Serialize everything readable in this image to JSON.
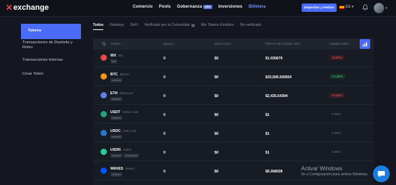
{
  "header": {
    "logo_mark": "✕",
    "logo_text": "exchange",
    "nav": [
      {
        "label": "Comercio",
        "active": false
      },
      {
        "label": "Pools",
        "active": false
      },
      {
        "label": "Gobernanza",
        "active": false,
        "badge": "NEW"
      },
      {
        "label": "Inversiones",
        "active": false
      },
      {
        "label": "Billetera",
        "active": true
      }
    ],
    "deposit_button": "Depositar y Retirar",
    "language": "ES",
    "icons": [
      "bell-icon",
      "avatar"
    ]
  },
  "sidebar": {
    "items": [
      {
        "label": "Tokens",
        "active": true
      },
      {
        "label": "Transacciones de Depósito y Retiro",
        "active": false
      },
      {
        "label": "Transacciones Internas",
        "active": false
      },
      {
        "label": "Crear Token",
        "active": false
      }
    ]
  },
  "tabs": [
    {
      "label": "Todos",
      "active": true
    },
    {
      "label": "Gateway",
      "active": false
    },
    {
      "label": "DeFi",
      "active": false
    },
    {
      "label": "Verificado por la Comunidad",
      "active": false,
      "info": true
    },
    {
      "label": "Mis Tokens Emitidos",
      "active": false
    },
    {
      "label": "No verificado",
      "active": false
    }
  ],
  "table": {
    "columns": [
      "TOKEN ↕",
      "SALDO ↕",
      "SALDO USD ↕",
      "PRECIO DEL TOKEN, USD ↕",
      "CAMBIO 24HS ↕"
    ],
    "rows": [
      {
        "symbol": "WX",
        "name": "WX",
        "tags": [
          "DEX"
        ],
        "balance": "0",
        "balance_usd": "$0",
        "price": "$1.030679",
        "change": "-5.57%",
        "trend": "neg",
        "icon_color": "#e64a4a",
        "icon": "wx-icon"
      },
      {
        "symbol": "BTC",
        "name": "Bitcoin",
        "tags": [
          "GATEWAY"
        ],
        "balance": "0",
        "balance_usd": "$0",
        "price": "$33,506.592824",
        "change": "+3.45%",
        "trend": "pos",
        "icon_color": "#f7931a",
        "icon": "bitcoin-icon"
      },
      {
        "symbol": "ETH",
        "name": "Ethereum",
        "tags": [
          "GATEWAY"
        ],
        "balance": "0",
        "balance_usd": "$0",
        "price": "$2,435.54394",
        "change": "-0.12%",
        "trend": "neg",
        "icon_color": "#627eea",
        "icon": "ethereum-icon"
      },
      {
        "symbol": "USDT",
        "name": "Tether USD",
        "tags": [
          "GATEWAY"
        ],
        "balance": "0",
        "balance_usd": "$0",
        "price": "$1",
        "change": "0.00%",
        "trend": "zero",
        "icon_color": "#26a17b",
        "icon": "tether-icon"
      },
      {
        "symbol": "USDC",
        "name": "USD Coin",
        "tags": [
          "GATEWAY"
        ],
        "balance": "0",
        "balance_usd": "$0",
        "price": "$1",
        "change": "0.00%",
        "trend": "zero",
        "icon_color": "#2775ca",
        "icon": "usdc-icon"
      },
      {
        "symbol": "USDN",
        "name": "USDN",
        "tags": [
          "GATEWAY",
          "STABLECOIN"
        ],
        "balance": "0",
        "balance_usd": "$0",
        "price": "$1",
        "change": "0.00%",
        "trend": "zero",
        "icon_color": "#2ecc9a",
        "icon": "usdn-icon"
      },
      {
        "symbol": "WAVES",
        "name": "Waves",
        "tags": [
          "GATEWAY"
        ],
        "balance": "0",
        "balance_usd": "$0",
        "price": "$9.268028",
        "change": "",
        "trend": "neg",
        "icon_color": "#0055ff",
        "icon": "waves-icon"
      }
    ]
  },
  "watermark": {
    "title": "Activar Windows",
    "subtitle": "Ve a Configuración para activar Windows."
  },
  "colors": {
    "accent": "#4a6bf5",
    "negative": "#ff5b5b",
    "positive": "#3ed08a"
  }
}
